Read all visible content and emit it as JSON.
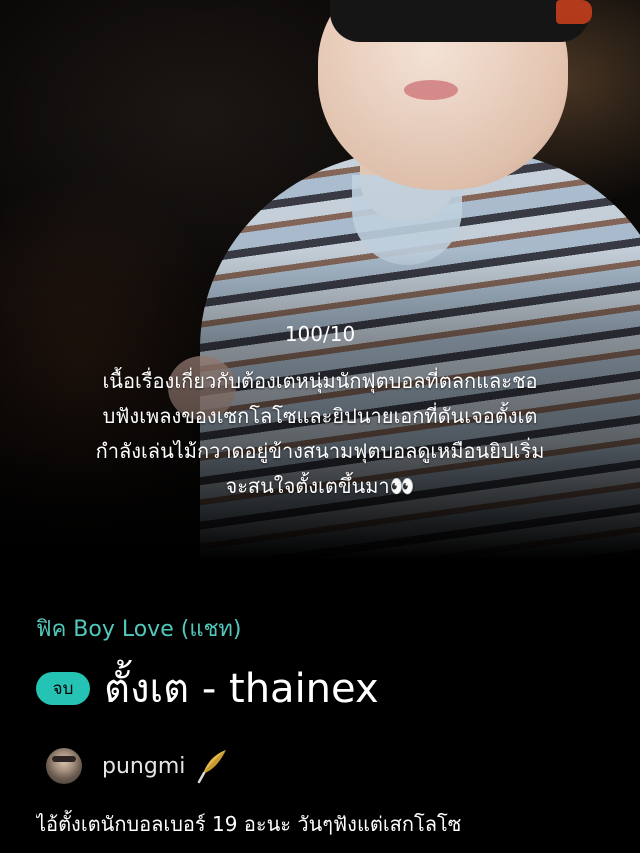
{
  "cover": {
    "rating": "100/10",
    "synopsis_lines": [
      "เนื้อเรื่องเกี่ยวกับต้องเตหนุ่มนักฟุตบอลที่ตลกและชอ",
      "บฟังเพลงของเซกโลโซและยิปนายเอกที่ดันเจอตั้งเต",
      "กำลังเล่นไม้กวาดอยู่ข้างสนามฟุตบอลดูเหมือนยิปเริ่ม",
      "จะสนใจตั้งเตขึ้นมา👀"
    ]
  },
  "story": {
    "category": "ฟิค Boy Love (แชท)",
    "status_badge": "จบ",
    "title": "ตั้งเต - thainex",
    "author": "pungmi",
    "author_badge_icon": "quill-icon",
    "tagline": "ไอ้ตั้งเตนักบอลเบอร์ 19 อะนะ วันๆฟังแต่เสกโลโซ"
  },
  "colors": {
    "background": "#000000",
    "category_text": "#52c8bc",
    "badge_bg": "#24c3b4",
    "quill": "#e0b84c"
  }
}
